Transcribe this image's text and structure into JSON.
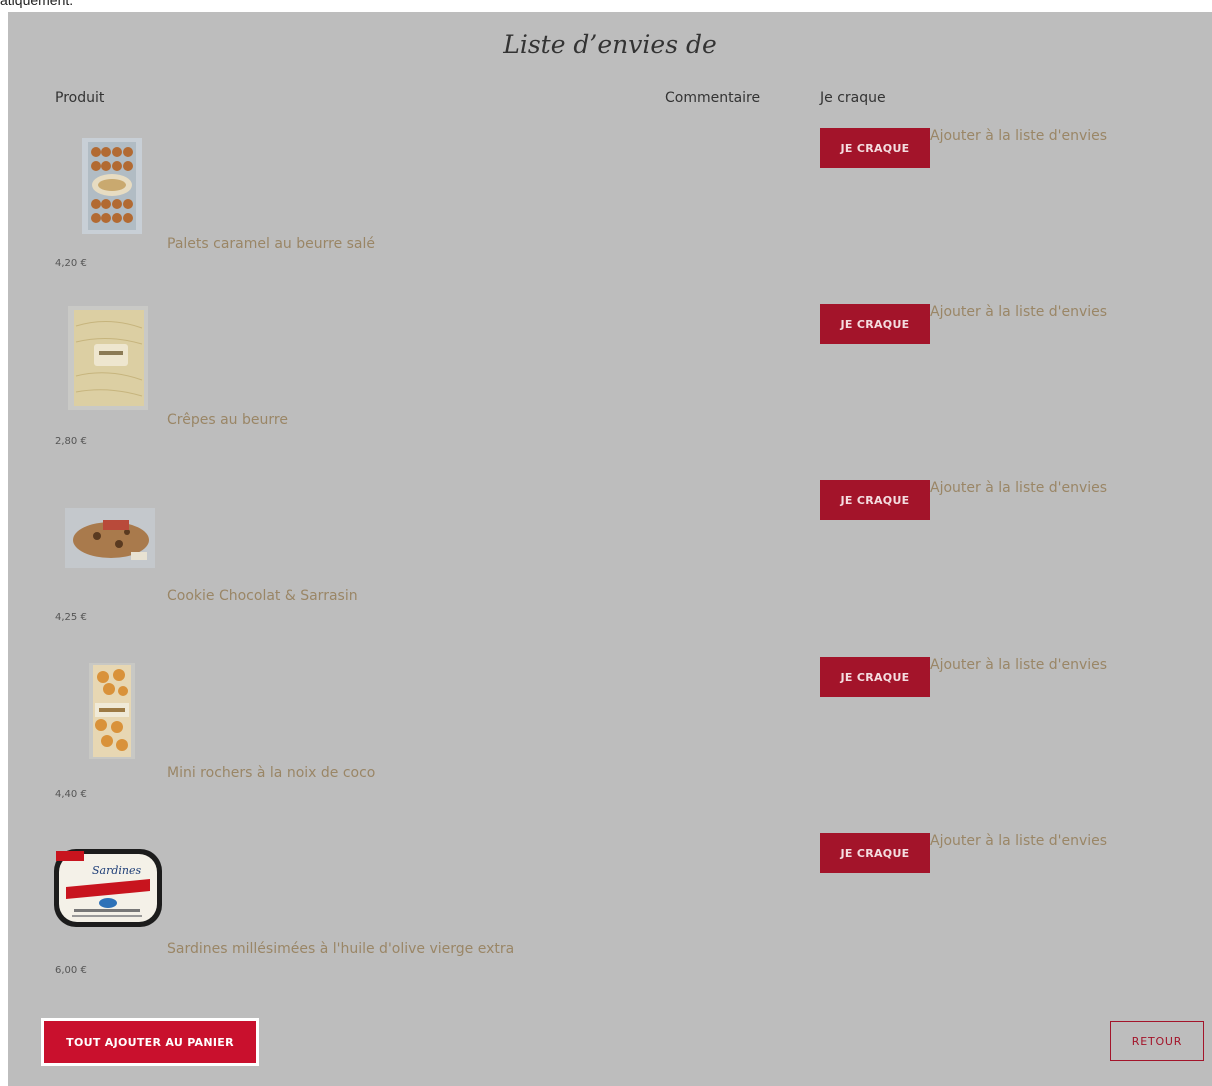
{
  "top_text": "atiquement.",
  "title": "Liste d’envies de",
  "headers": {
    "product": "Produit",
    "comment": "Commentaire",
    "craque": "Je craque"
  },
  "items": [
    {
      "name": "Palets caramel au beurre salé",
      "price": "4,20 €",
      "button": "JE CRAQUE",
      "wishlist_link": "Ajouter à la liste d'envies"
    },
    {
      "name": "Crêpes au beurre",
      "price": "2,80 €",
      "button": "JE CRAQUE",
      "wishlist_link": "Ajouter à la liste d'envies"
    },
    {
      "name": "Cookie Chocolat & Sarrasin",
      "price": "4,25 €",
      "button": "JE CRAQUE",
      "wishlist_link": "Ajouter à la liste d'envies"
    },
    {
      "name": "Mini rochers à la noix de coco",
      "price": "4,40 €",
      "button": "JE CRAQUE",
      "wishlist_link": "Ajouter à la liste d'envies"
    },
    {
      "name": "Sardines millésimées à l'huile d'olive vierge extra",
      "price": "6,00 €",
      "button": "JE CRAQUE",
      "wishlist_link": "Ajouter à la liste d'envies"
    }
  ],
  "sardine_label": "Sardines",
  "actions": {
    "add_all": "TOUT AJOUTER AU PANIER",
    "back": "RETOUR"
  },
  "colors": {
    "panel_bg": "#bdbdbd",
    "button_red": "#a3142a",
    "primary_red": "#c9102d",
    "link_tan": "#9a8666"
  }
}
